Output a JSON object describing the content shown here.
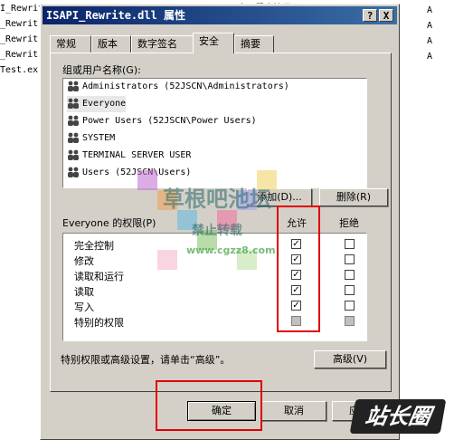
{
  "background": {
    "left_rows": [
      "I_Rewrit",
      "_Rewrit",
      "_Rewrit",
      "_Rewrit",
      "Test.ex"
    ],
    "right_letter": "A",
    "top_text": "应用程序扩展"
  },
  "dialog": {
    "title": "ISAPI_Rewrite.dll 属性",
    "title_buttons": [
      "?",
      "X"
    ],
    "tabs": [
      "常规",
      "版本",
      "数字签名",
      "安全",
      "摘要"
    ],
    "active_tab": "安全",
    "users_label": "组或用户名称(G):",
    "users": [
      "Administrators (52JSCN\\Administrators)",
      "Everyone",
      "Power Users (52JSCN\\Power Users)",
      "SYSTEM",
      "TERMINAL SERVER USER",
      "Users (52JSCN\\Users)"
    ],
    "selected_user": "Everyone",
    "add_button": "添加(D)...",
    "remove_button": "删除(R)",
    "perm_label": "Everyone 的权限(P)",
    "allow_header": "允许",
    "deny_header": "拒绝",
    "permissions": [
      {
        "name": "完全控制",
        "allow": "checked",
        "deny": "empty"
      },
      {
        "name": "修改",
        "allow": "checked",
        "deny": "empty"
      },
      {
        "name": "读取和运行",
        "allow": "checked",
        "deny": "empty"
      },
      {
        "name": "读取",
        "allow": "checked",
        "deny": "empty"
      },
      {
        "name": "写入",
        "allow": "checked",
        "deny": "empty"
      },
      {
        "name": "特别的权限",
        "allow": "grey",
        "deny": "grey"
      }
    ],
    "advanced_note": "特别权限或高级设置，请单击“高级”。",
    "advanced_button": "高级(V)",
    "ok_button": "确定",
    "cancel_button": "取消",
    "apply_button": "应用"
  },
  "watermark": {
    "line1": "草根吧池坛",
    "line2": "禁止转载",
    "line3": "www.cgzz8.com"
  },
  "logo_text": "站长圈",
  "colors": {
    "title_bar": "#0a246a",
    "highlight": "#e00000",
    "face": "#d4d0c8"
  }
}
